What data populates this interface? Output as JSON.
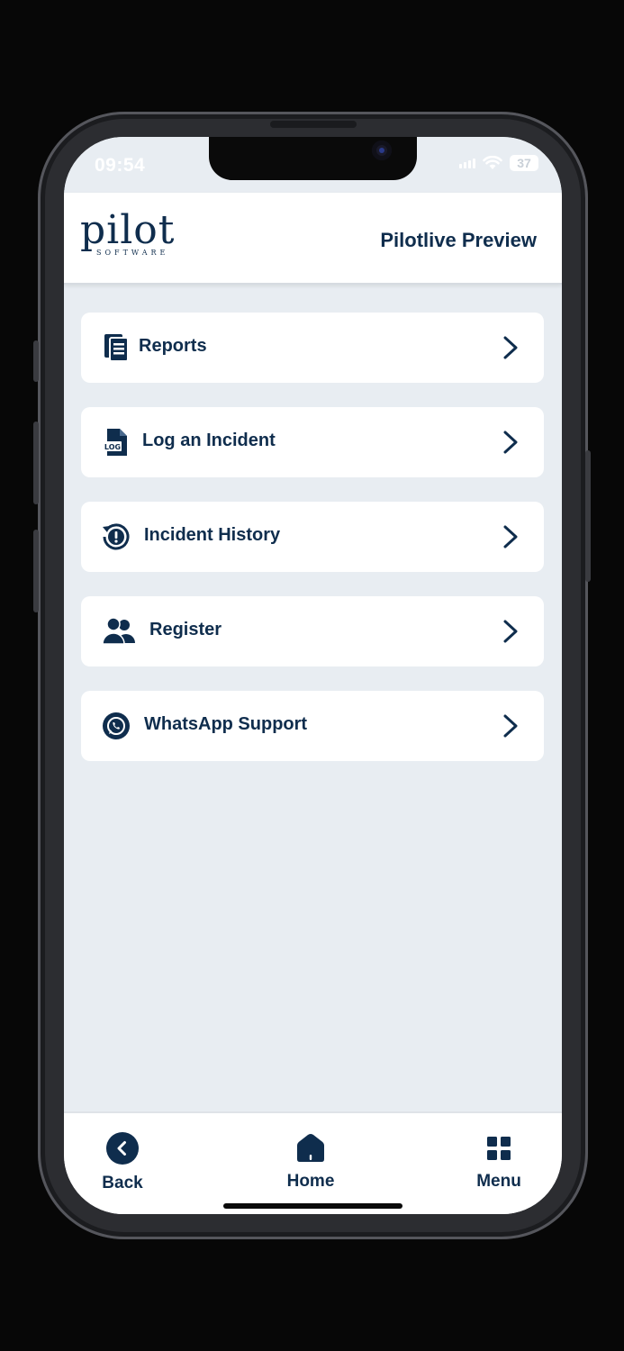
{
  "status_bar": {
    "time": "09:54",
    "battery": "37"
  },
  "header": {
    "logo_text": "pilot",
    "logo_subtext": "SOFTWARE",
    "title": "Pilotlive Preview"
  },
  "menu": {
    "items": [
      {
        "label": "Reports",
        "icon": "document-icon"
      },
      {
        "label": "Log an Incident",
        "icon": "log-file-icon"
      },
      {
        "label": "Incident History",
        "icon": "history-alert-icon"
      },
      {
        "label": "Register",
        "icon": "users-icon"
      },
      {
        "label": "WhatsApp Support",
        "icon": "whatsapp-icon"
      }
    ]
  },
  "bottom_nav": {
    "back": "Back",
    "home": "Home",
    "menu": "Menu"
  },
  "colors": {
    "primary": "#0f2d4d",
    "background": "#e8edf2",
    "card": "#ffffff"
  }
}
